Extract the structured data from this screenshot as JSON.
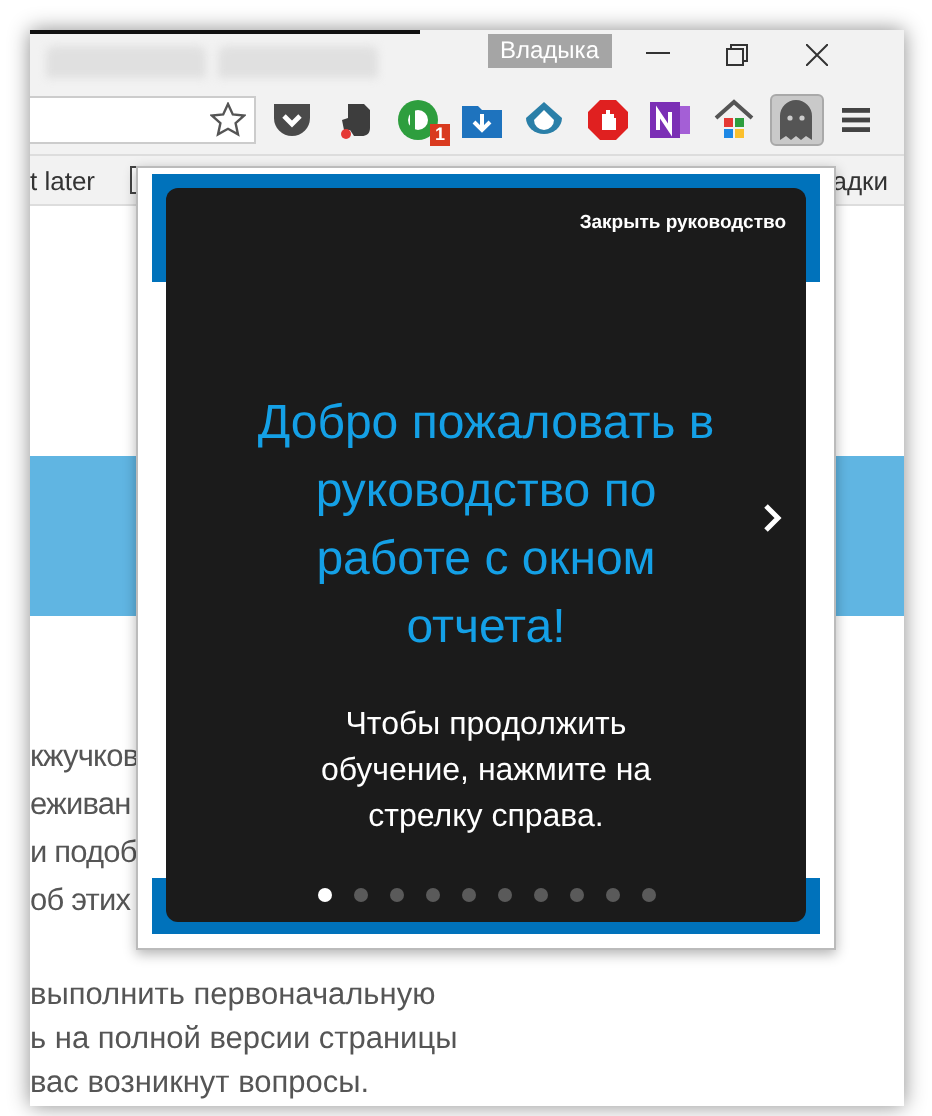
{
  "window": {
    "profile": "Владыка"
  },
  "toolbar": {
    "extensions": [
      {
        "kind": "pocket",
        "selected": false
      },
      {
        "kind": "elephant",
        "selected": false
      },
      {
        "kind": "ring",
        "selected": false,
        "badge": "1"
      },
      {
        "kind": "folder",
        "selected": false
      },
      {
        "kind": "drop",
        "selected": false
      },
      {
        "kind": "stop",
        "selected": false
      },
      {
        "kind": "notebook",
        "selected": false
      },
      {
        "kind": "home",
        "selected": false
      },
      {
        "kind": "ghost",
        "selected": true
      }
    ]
  },
  "bookmarks": {
    "left": "t later",
    "right": "адки"
  },
  "page": {
    "lines": [
      "кжучков",
      "еживан",
      "и подоб",
      "об этих",
      "выполнить первоначальную",
      "ь на полной версии страницы",
      "вас возникнут вопросы."
    ]
  },
  "tour": {
    "close": "Закрыть руководство",
    "title": "Добро пожаловать в руководство по работе с окном отчета!",
    "text": "Чтобы продолжить обучение, нажмите на стрелку справа.",
    "dots": [
      {
        "selected": true
      },
      {
        "selected": false
      },
      {
        "selected": false
      },
      {
        "selected": false
      },
      {
        "selected": false
      },
      {
        "selected": false
      },
      {
        "selected": false
      },
      {
        "selected": false
      },
      {
        "selected": false
      },
      {
        "selected": false
      }
    ]
  }
}
